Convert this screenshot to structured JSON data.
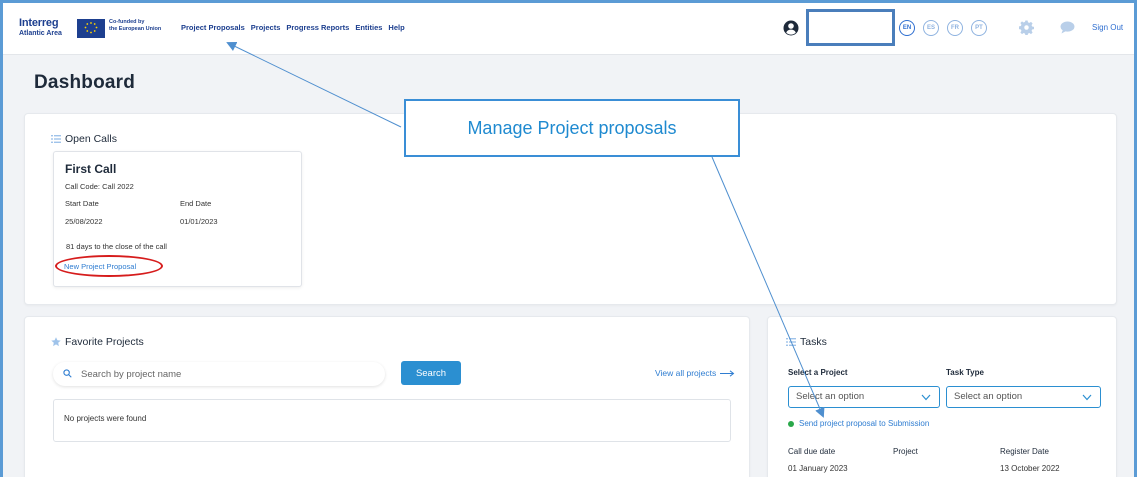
{
  "header": {
    "logo_line1": "Interreg",
    "logo_line2": "Atlantic Area",
    "cofunded_line1": "Co-funded by",
    "cofunded_line2": "the European Union",
    "nav": [
      "Project Proposals",
      "Projects",
      "Progress Reports",
      "Entities",
      "Help"
    ],
    "languages": [
      "EN",
      "ES",
      "FR",
      "PT"
    ],
    "active_language": "EN",
    "signout": "Sign Out"
  },
  "page": {
    "title": "Dashboard"
  },
  "open_calls": {
    "heading": "Open Calls",
    "call": {
      "title": "First Call",
      "code": "Call Code: Call 2022",
      "start_label": "Start Date",
      "end_label": "End Date",
      "start_date": "25/08/2022",
      "end_date": "01/01/2023",
      "days_left": "81 days to the close of the call",
      "link": "New Project Proposal"
    }
  },
  "favorites": {
    "heading": "Favorite Projects",
    "search_placeholder": "Search by project name",
    "search_button": "Search",
    "view_all": "View all projects",
    "empty": "No projects were found"
  },
  "tasks": {
    "heading": "Tasks",
    "project_label": "Select a Project",
    "type_label": "Task Type",
    "project_select": "Select an option",
    "type_select": "Select an option",
    "item": "Send project proposal to Submission",
    "columns": [
      "Call due date",
      "Project",
      "Register Date"
    ],
    "row": {
      "due": "01 January 2023",
      "project": "",
      "register": "13 October 2022"
    }
  },
  "annotation": {
    "callout": "Manage Project proposals",
    "arrow_color": "#4f8fcf",
    "oval_color": "#d61c1c"
  },
  "colors": {
    "brand": "#1d3f8f",
    "accent": "#2b8fd1",
    "status_green": "#2aa84a"
  }
}
